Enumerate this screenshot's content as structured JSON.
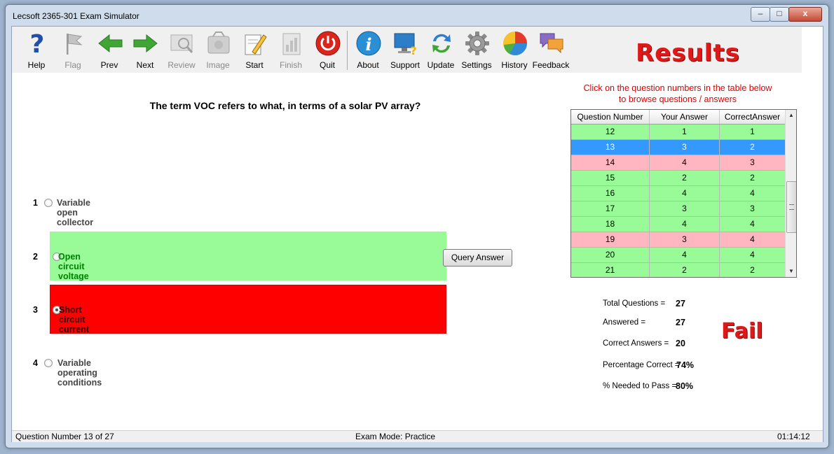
{
  "window": {
    "title": "Lecsoft 2365-301 Exam Simulator",
    "controls": {
      "minimize": "–",
      "maximize": "□",
      "close": "x"
    }
  },
  "toolbar": {
    "items": [
      {
        "label": "Help",
        "icon": "help-icon",
        "enabled": true
      },
      {
        "label": "Flag",
        "icon": "flag-icon",
        "enabled": false
      },
      {
        "label": "Prev",
        "icon": "arrow-left-icon",
        "enabled": true
      },
      {
        "label": "Next",
        "icon": "arrow-right-icon",
        "enabled": true
      },
      {
        "label": "Review",
        "icon": "review-magnifier-icon",
        "enabled": false
      },
      {
        "label": "Image",
        "icon": "image-tag-icon",
        "enabled": false
      },
      {
        "label": "Start",
        "icon": "start-pencil-icon",
        "enabled": true
      },
      {
        "label": "Finish",
        "icon": "finish-chart-icon",
        "enabled": false
      },
      {
        "label": "Quit",
        "icon": "power-icon",
        "enabled": true
      },
      {
        "label": "About",
        "icon": "info-icon",
        "enabled": true
      },
      {
        "label": "Support",
        "icon": "support-monitor-icon",
        "enabled": true
      },
      {
        "label": "Update",
        "icon": "update-arrows-icon",
        "enabled": true
      },
      {
        "label": "Settings",
        "icon": "gear-icon",
        "enabled": true
      },
      {
        "label": "History",
        "icon": "history-pie-icon",
        "enabled": true
      },
      {
        "label": "Feedback",
        "icon": "feedback-bubbles-icon",
        "enabled": true
      }
    ]
  },
  "results": {
    "title": "Results",
    "hint_line1": "Click on the question numbers in the table below",
    "hint_line2": "to browse questions / answers",
    "status": "Fail"
  },
  "question": {
    "text": "The term VOC refers to what, in terms of a solar PV array?",
    "query_button": "Query Answer",
    "options": [
      {
        "number": "1",
        "text": "Variable open collector",
        "state": "none",
        "checked": false
      },
      {
        "number": "2",
        "text": "Open circuit voltage",
        "state": "correct",
        "checked": false
      },
      {
        "number": "3",
        "text": "Short circuit current",
        "state": "wrong",
        "checked": true
      },
      {
        "number": "4",
        "text": "Variable operating conditions",
        "state": "none",
        "checked": false
      }
    ]
  },
  "table": {
    "headers": [
      "Question Number",
      "Your Answer",
      "CorrectAnswer"
    ],
    "rows": [
      {
        "q": "12",
        "yours": "1",
        "correct": "1",
        "status": "correct"
      },
      {
        "q": "13",
        "yours": "3",
        "correct": "2",
        "status": "selected"
      },
      {
        "q": "14",
        "yours": "4",
        "correct": "3",
        "status": "wrong"
      },
      {
        "q": "15",
        "yours": "2",
        "correct": "2",
        "status": "correct"
      },
      {
        "q": "16",
        "yours": "4",
        "correct": "4",
        "status": "correct"
      },
      {
        "q": "17",
        "yours": "3",
        "correct": "3",
        "status": "correct"
      },
      {
        "q": "18",
        "yours": "4",
        "correct": "4",
        "status": "correct"
      },
      {
        "q": "19",
        "yours": "3",
        "correct": "4",
        "status": "wrong"
      },
      {
        "q": "20",
        "yours": "4",
        "correct": "4",
        "status": "correct"
      },
      {
        "q": "21",
        "yours": "2",
        "correct": "2",
        "status": "correct"
      }
    ]
  },
  "stats": {
    "total_label": "Total Questions =",
    "total": "27",
    "answered_label": "Answered =",
    "answered": "27",
    "correct_label": "Correct Answers =",
    "correct": "20",
    "percent_label": "Percentage Correct =",
    "percent": "74%",
    "needed_label": "% Needed to Pass =",
    "needed": "80%"
  },
  "statusbar": {
    "question_number": "Question Number 13 of 27",
    "mode": "Exam Mode: Practice",
    "time": "01:14:12"
  },
  "colors": {
    "correct": "#98fb98",
    "wrong": "#ffb6c1",
    "selected": "#3399ff",
    "answer_wrong_fill": "#ff0000",
    "answer_correct_text": "#008000",
    "title_red": "#e01818"
  }
}
